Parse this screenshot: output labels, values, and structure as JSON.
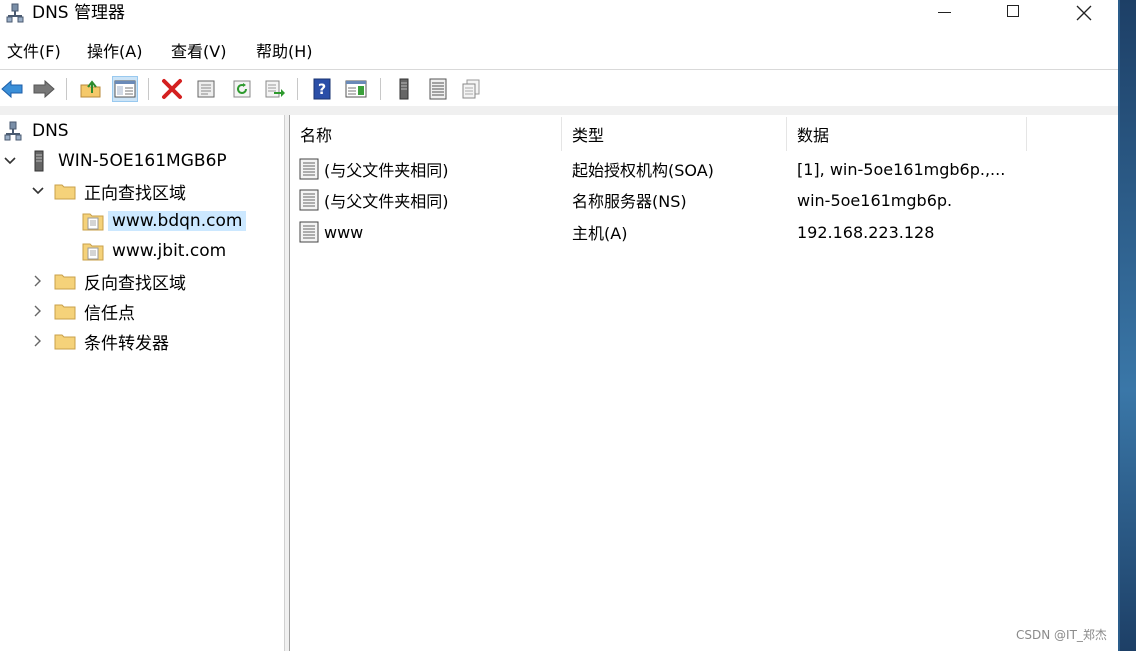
{
  "window": {
    "title": "DNS 管理器"
  },
  "menu": [
    "文件(F)",
    "操作(A)",
    "查看(V)",
    "帮助(H)"
  ],
  "toolbar": [
    "back-icon",
    "forward-icon",
    "up-folder-icon",
    "show-hide-tree-icon",
    "delete-icon",
    "properties-icon",
    "refresh-icon",
    "export-list-icon",
    "help-icon",
    "show-hide-action-pane-icon",
    "server-icon",
    "list-icon",
    "copy-icon"
  ],
  "tree": {
    "root": "DNS",
    "server": "WIN-5OE161MGB6P",
    "forward_zones": "正向查找区域",
    "zones": [
      "www.bdqn.com",
      "www.jbit.com"
    ],
    "reverse_zones": "反向查找区域",
    "trust_points": "信任点",
    "conditional_forwarders": "条件转发器"
  },
  "list": {
    "columns": [
      "名称",
      "类型",
      "数据"
    ],
    "rows": [
      {
        "name": "(与父文件夹相同)",
        "type": "起始授权机构(SOA)",
        "data": "[1], win-5oe161mgb6p.,..."
      },
      {
        "name": "(与父文件夹相同)",
        "type": "名称服务器(NS)",
        "data": "win-5oe161mgb6p."
      },
      {
        "name": "www",
        "type": "主机(A)",
        "data": "192.168.223.128"
      }
    ]
  },
  "watermark": "CSDN @IT_郑杰",
  "colors": {
    "selection": "#cce8ff",
    "toolbar_active": "#cce4f7",
    "folder": "#f5d27a",
    "delete_red": "#d42020",
    "help_blue": "#2b4fa8"
  }
}
